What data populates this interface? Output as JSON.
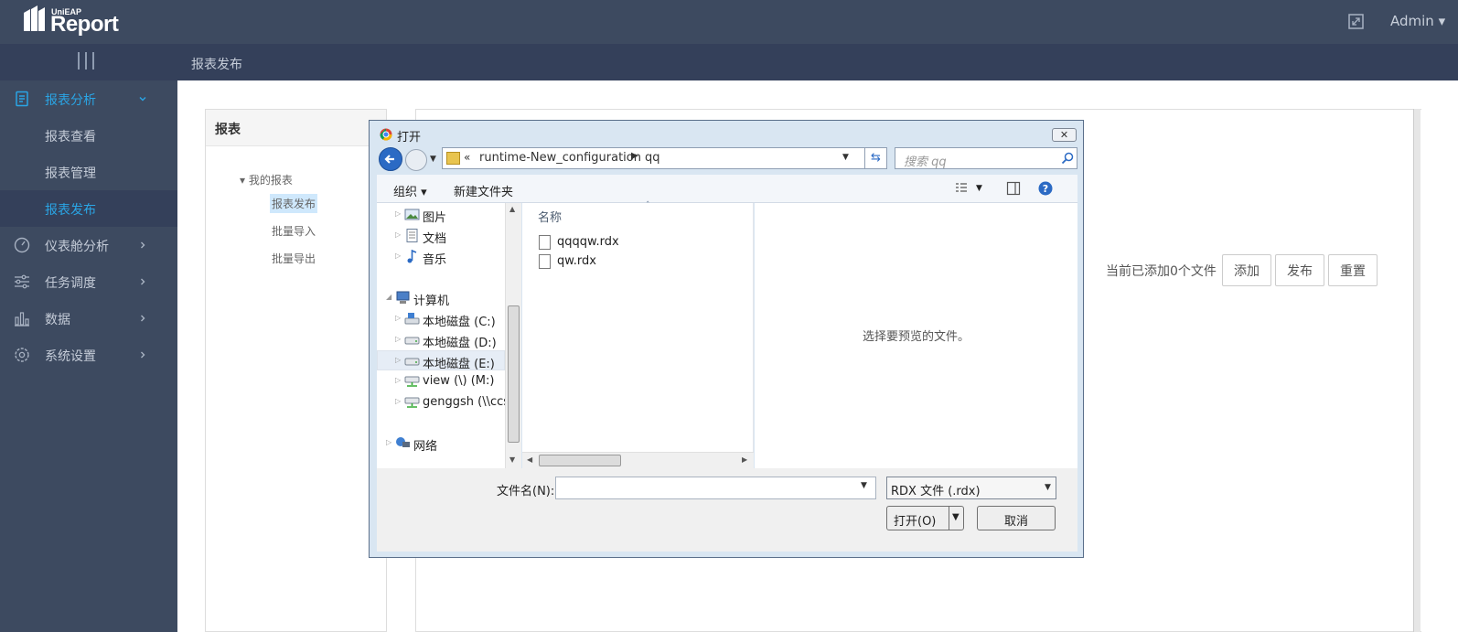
{
  "app": {
    "brand_small": "UniEAP",
    "brand_name": "Report",
    "user": "Admin ▾"
  },
  "breadcrumb": "报表发布",
  "sidebar": {
    "items": [
      {
        "label": "报表分析",
        "icon": "report-icon",
        "expanded": true
      },
      {
        "label": "仪表舱分析",
        "icon": "gauge-icon"
      },
      {
        "label": "任务调度",
        "icon": "sliders-icon"
      },
      {
        "label": "数据",
        "icon": "bar-chart-icon"
      },
      {
        "label": "系统设置",
        "icon": "gear-icon"
      }
    ],
    "sub_items": [
      {
        "label": "报表查看"
      },
      {
        "label": "报表管理"
      },
      {
        "label": "报表发布",
        "active": true
      }
    ]
  },
  "report_panel": {
    "title": "报表",
    "tree_root": "▾ 我的报表",
    "tree_items": [
      "报表发布",
      "批量导入",
      "批量导出"
    ]
  },
  "publish": {
    "status": "当前已添加0个文件",
    "add_label": "添加",
    "publish_label": "发布",
    "reset_label": "重置"
  },
  "dialog": {
    "title": "打开",
    "close_label": "✕",
    "path_prefix": "«",
    "path": [
      "runtime-New_configuration",
      "qq"
    ],
    "search_placeholder": "搜索 qq",
    "toolbar": {
      "organize": "组织 ▾",
      "new_folder": "新建文件夹"
    },
    "nav_tree": [
      {
        "label": "图片",
        "icon": "picture-icon"
      },
      {
        "label": "文档",
        "icon": "document-icon"
      },
      {
        "label": "音乐",
        "icon": "music-icon"
      },
      {
        "label": "计算机",
        "icon": "computer-icon"
      },
      {
        "label": "本地磁盘 (C:)",
        "icon": "drive-icon"
      },
      {
        "label": "本地磁盘 (D:)",
        "icon": "drive-icon"
      },
      {
        "label": "本地磁盘 (E:)",
        "icon": "drive-icon",
        "selected": true
      },
      {
        "label": "view (\\) (M:)",
        "icon": "network-drive-icon"
      },
      {
        "label": "genggsh (\\\\ccse",
        "icon": "network-drive-icon"
      },
      {
        "label": "网络",
        "icon": "network-icon"
      }
    ],
    "column_header": "名称",
    "files": [
      "qqqqw.rdx",
      "qw.rdx"
    ],
    "preview_text": "选择要预览的文件。",
    "filename_label": "文件名(N):",
    "filename_value": "",
    "filetype": "RDX 文件 (.rdx)",
    "open_label": "打开(O)",
    "cancel_label": "取消"
  },
  "colors": {
    "sidebar": "#3d4a60",
    "subbar": "#34405a",
    "accent": "#2aa5e5"
  }
}
